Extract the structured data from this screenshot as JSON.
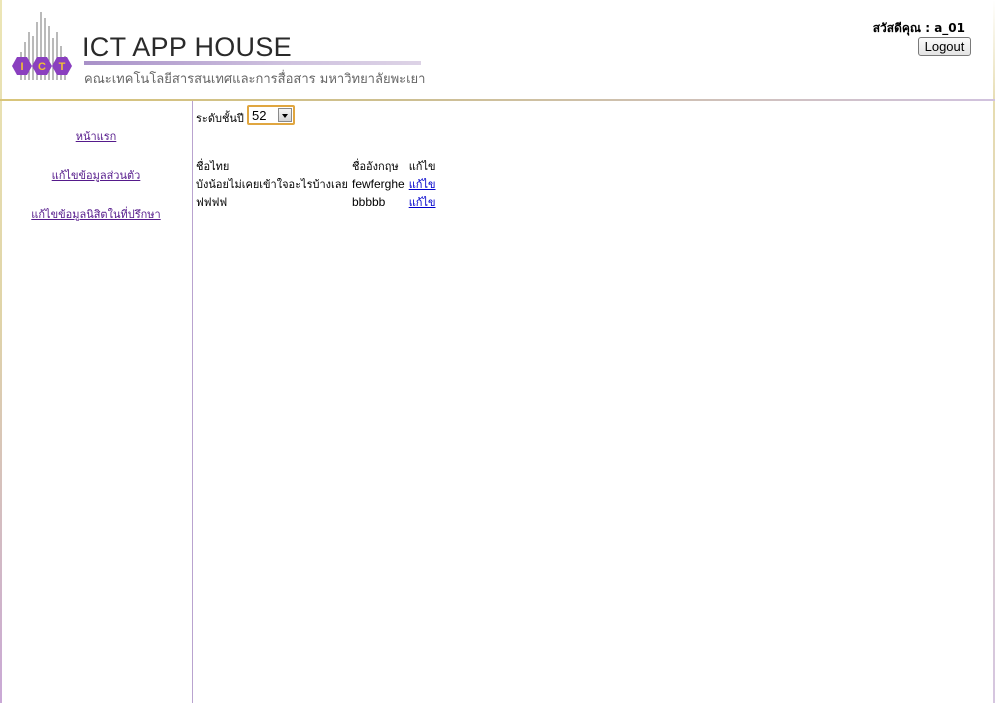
{
  "header": {
    "site_title": "ICT APP HOUSE",
    "site_subtitle": "คณะเทคโนโลยีสารสนเทศและการสื่อสาร มหาวิทยาลัยพะเยา",
    "logo_text": "ICT",
    "greeting": "สวัสดีคุณ : a_01",
    "logout_label": "Logout"
  },
  "sidebar": {
    "items": [
      {
        "label": "หน้าแรก"
      },
      {
        "label": "แก้ไขข้อมูลส่วนตัว"
      },
      {
        "label": "แก้ไขข้อมูลนิสิตในที่ปรึกษา"
      }
    ]
  },
  "main": {
    "level_label": "ระดับชั้นปี",
    "level_value": "52",
    "table": {
      "headers": [
        "ชื่อไทย",
        "ชื่ออังกฤษ",
        "แก้ไข"
      ],
      "rows": [
        {
          "thai": "บังน้อยไม่เคยเข้าใจอะไรบ้างเลย",
          "eng": "fewferghe",
          "edit": "แก้ไข"
        },
        {
          "thai": "ฟฟฟฟ",
          "eng": "bbbbb",
          "edit": "แก้ไข"
        }
      ]
    }
  },
  "colors": {
    "accent_purple": "#8a3fbf",
    "link_visited": "#551a8b",
    "link": "#0000cc",
    "select_border": "#e0a640"
  }
}
